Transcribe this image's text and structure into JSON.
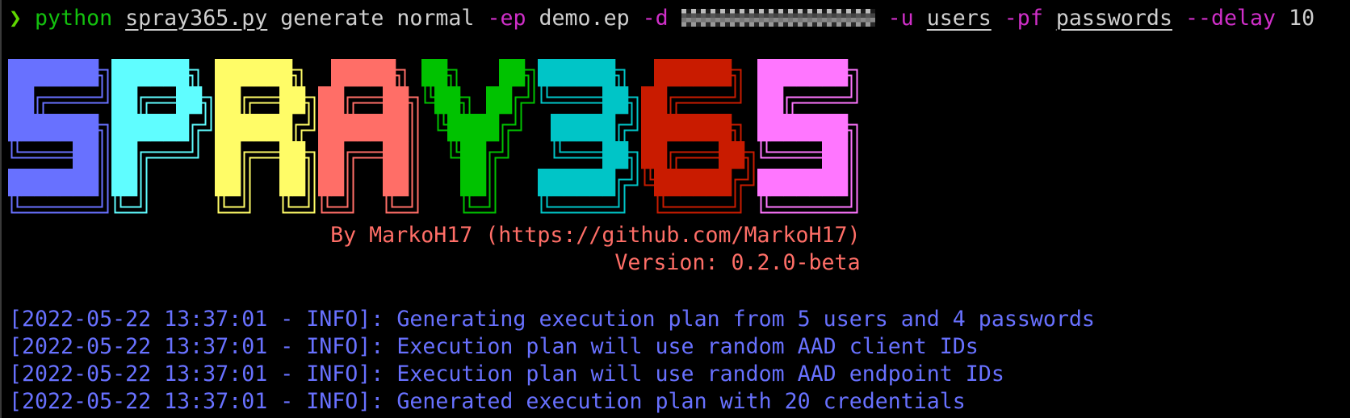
{
  "terminal": {
    "command": {
      "prompt": "❯",
      "program": "python",
      "script": "spray365.py",
      "subcommand": "generate normal",
      "flag_ep": "-ep",
      "ep_value": "demo.ep",
      "flag_d": "-d",
      "flag_u": "-u",
      "u_value": "users",
      "flag_pf": "-pf",
      "pf_value": "passwords",
      "flag_delay": "--delay",
      "delay_value": "10"
    },
    "banner": {
      "logo_text": "SPRAY365",
      "letter_colors": [
        "#6871ff",
        "#5ffdff",
        "#fffc67",
        "#ff6e67",
        "#00c200",
        "#00c5c7",
        "#c91b00",
        "#ff76ff"
      ],
      "byline": "By MarkoH17 (https://github.com/MarkoH17)",
      "version": "Version: 0.2.0-beta"
    },
    "log_lines": [
      "[2022-05-22 13:37:01 - INFO]: Generating execution plan from 5 users and 4 passwords",
      "[2022-05-22 13:37:01 - INFO]: Execution plan will use random AAD client IDs",
      "[2022-05-22 13:37:01 - INFO]: Execution plan will use random AAD endpoint IDs",
      "[2022-05-22 13:37:01 - INFO]: Generated execution plan with 20 credentials"
    ],
    "colors": {
      "background": "#000000",
      "program": "#13c10e",
      "flags": "#d02fc9",
      "banner_text": "#ff6e67",
      "log_text": "#6871ff"
    }
  }
}
